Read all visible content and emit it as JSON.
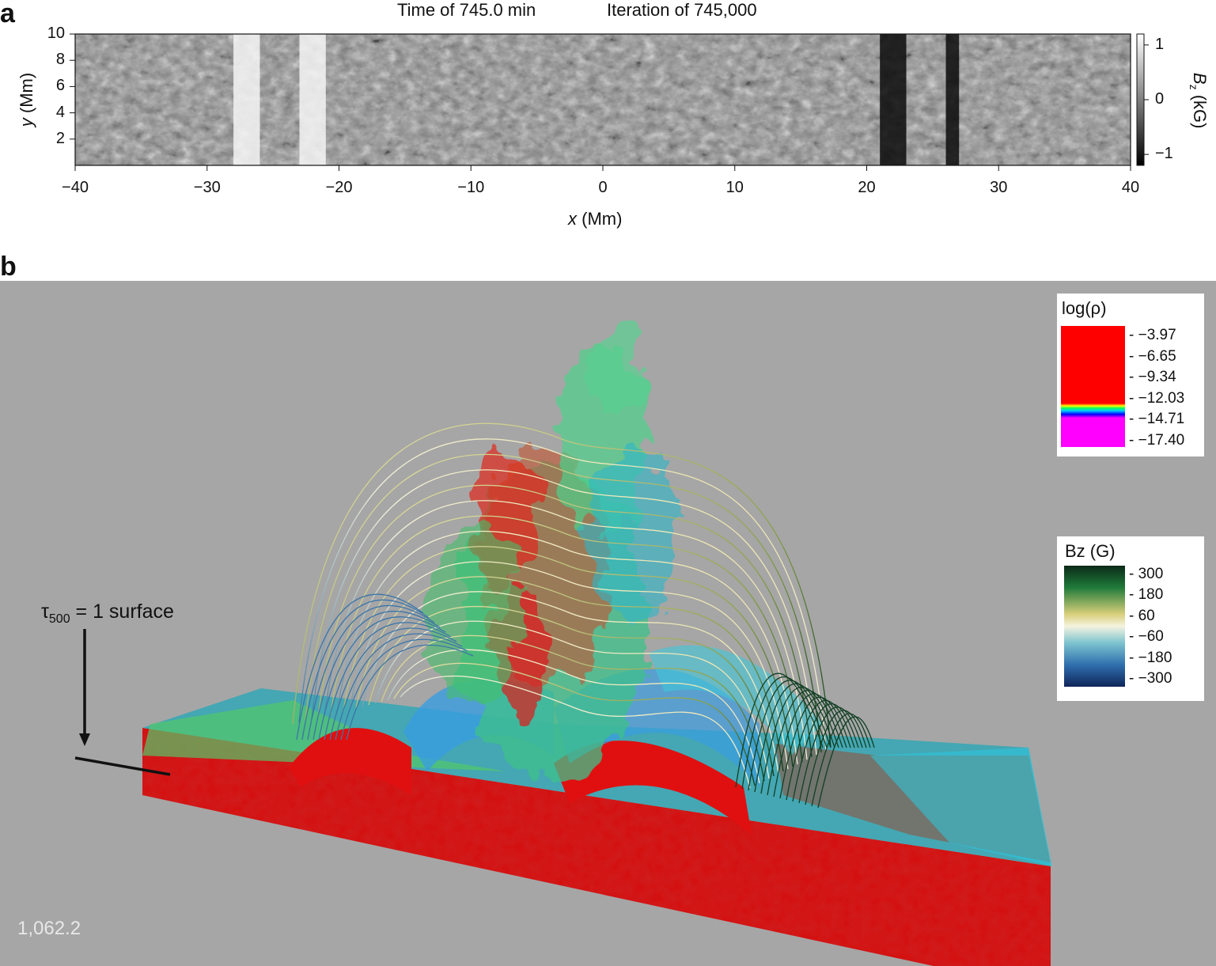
{
  "panel_a": {
    "letter": "a",
    "title_time": "Time of 745.0 min",
    "title_iteration": "Iteration of 745,000",
    "x_ticks": [
      "−40",
      "−30",
      "−20",
      "−10",
      "0",
      "10",
      "20",
      "30",
      "40"
    ],
    "y_ticks": [
      "10",
      "8",
      "6",
      "4",
      "2"
    ],
    "x_label_var": "x",
    "x_label_unit": " (Mm)",
    "y_label_var": "y",
    "y_label_unit": " (Mm)",
    "colorbar": {
      "label_var": "B",
      "label_sub": "z",
      "label_unit": " (kG)",
      "ticks": [
        "1",
        "0",
        "−1"
      ]
    }
  },
  "panel_b": {
    "letter": "b",
    "density_legend": {
      "title": "log(ρ)",
      "ticks": [
        "−3.97",
        "−6.65",
        "−9.34",
        "−12.03",
        "−14.71",
        "−17.40"
      ]
    },
    "bz_legend": {
      "title": "Bz (G)",
      "ticks": [
        "300",
        "180",
        "60",
        "−60",
        "−180",
        "−300"
      ]
    },
    "tau_label": {
      "symbol": "τ",
      "sub": "500",
      "text": " = 1 surface"
    },
    "frame_number": "1,062.2"
  },
  "colors": {
    "background_3d": "#a6a6a6",
    "red": "#d50d0d",
    "density_red": "#ff0000",
    "density_magenta": "#ff00ff"
  },
  "chart_data": {
    "type": "heatmap",
    "quantity": "B_z",
    "units": "kG",
    "x_range": [
      -40,
      40
    ],
    "y_range": [
      0,
      10
    ],
    "color_range": [
      -1.2,
      1.2
    ],
    "colormap": "grayscale",
    "strong_positive_bands_x": [
      [
        -28,
        -26
      ],
      [
        -23,
        -21
      ]
    ],
    "strong_negative_bands_x": [
      [
        21,
        23
      ],
      [
        26,
        27
      ]
    ]
  }
}
